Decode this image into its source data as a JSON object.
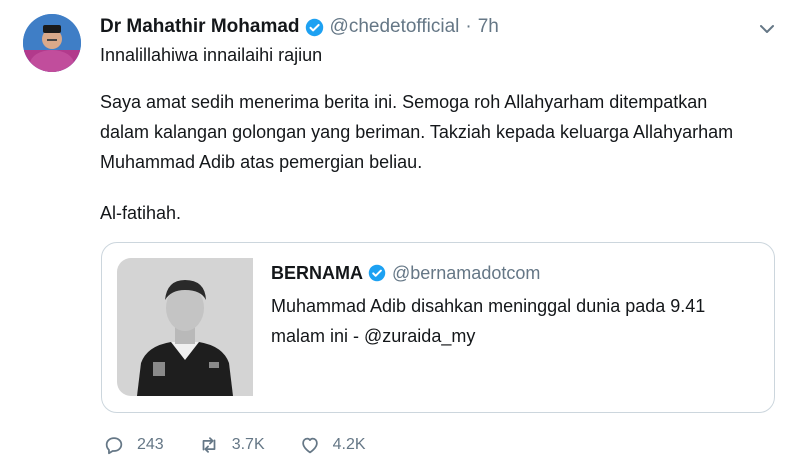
{
  "tweet": {
    "author": {
      "name": "Dr Mahathir Mohamad",
      "handle": "@chedetofficial",
      "separator": "·",
      "time": "7h"
    },
    "lines": [
      "Innalillahiwa innailaihi rajiun",
      "Saya amat sedih menerima berita ini. Semoga roh Allahyarham ditempatkan",
      "dalam kalangan golongan yang beriman. Takziah kepada keluarga Allahyarham",
      "Muhammad Adib atas pemergian beliau.",
      "Al-fatihah."
    ],
    "quoted": {
      "name": "BERNAMA",
      "handle": "@bernamadotcom",
      "lines": [
        "Muhammad Adib disahkan meninggal dunia pada 9.41",
        "malam ini - @zuraida_my"
      ]
    },
    "stats": {
      "replies": "243",
      "retweets": "3.7K",
      "likes": "4.2K"
    }
  },
  "icons": [
    "verified-badge-icon",
    "chevron-down-icon",
    "reply-icon",
    "retweet-icon",
    "like-icon"
  ],
  "colors": {
    "verified": "#1da1f2",
    "secondary_text": "#657786",
    "border": "#ccd6dd"
  }
}
